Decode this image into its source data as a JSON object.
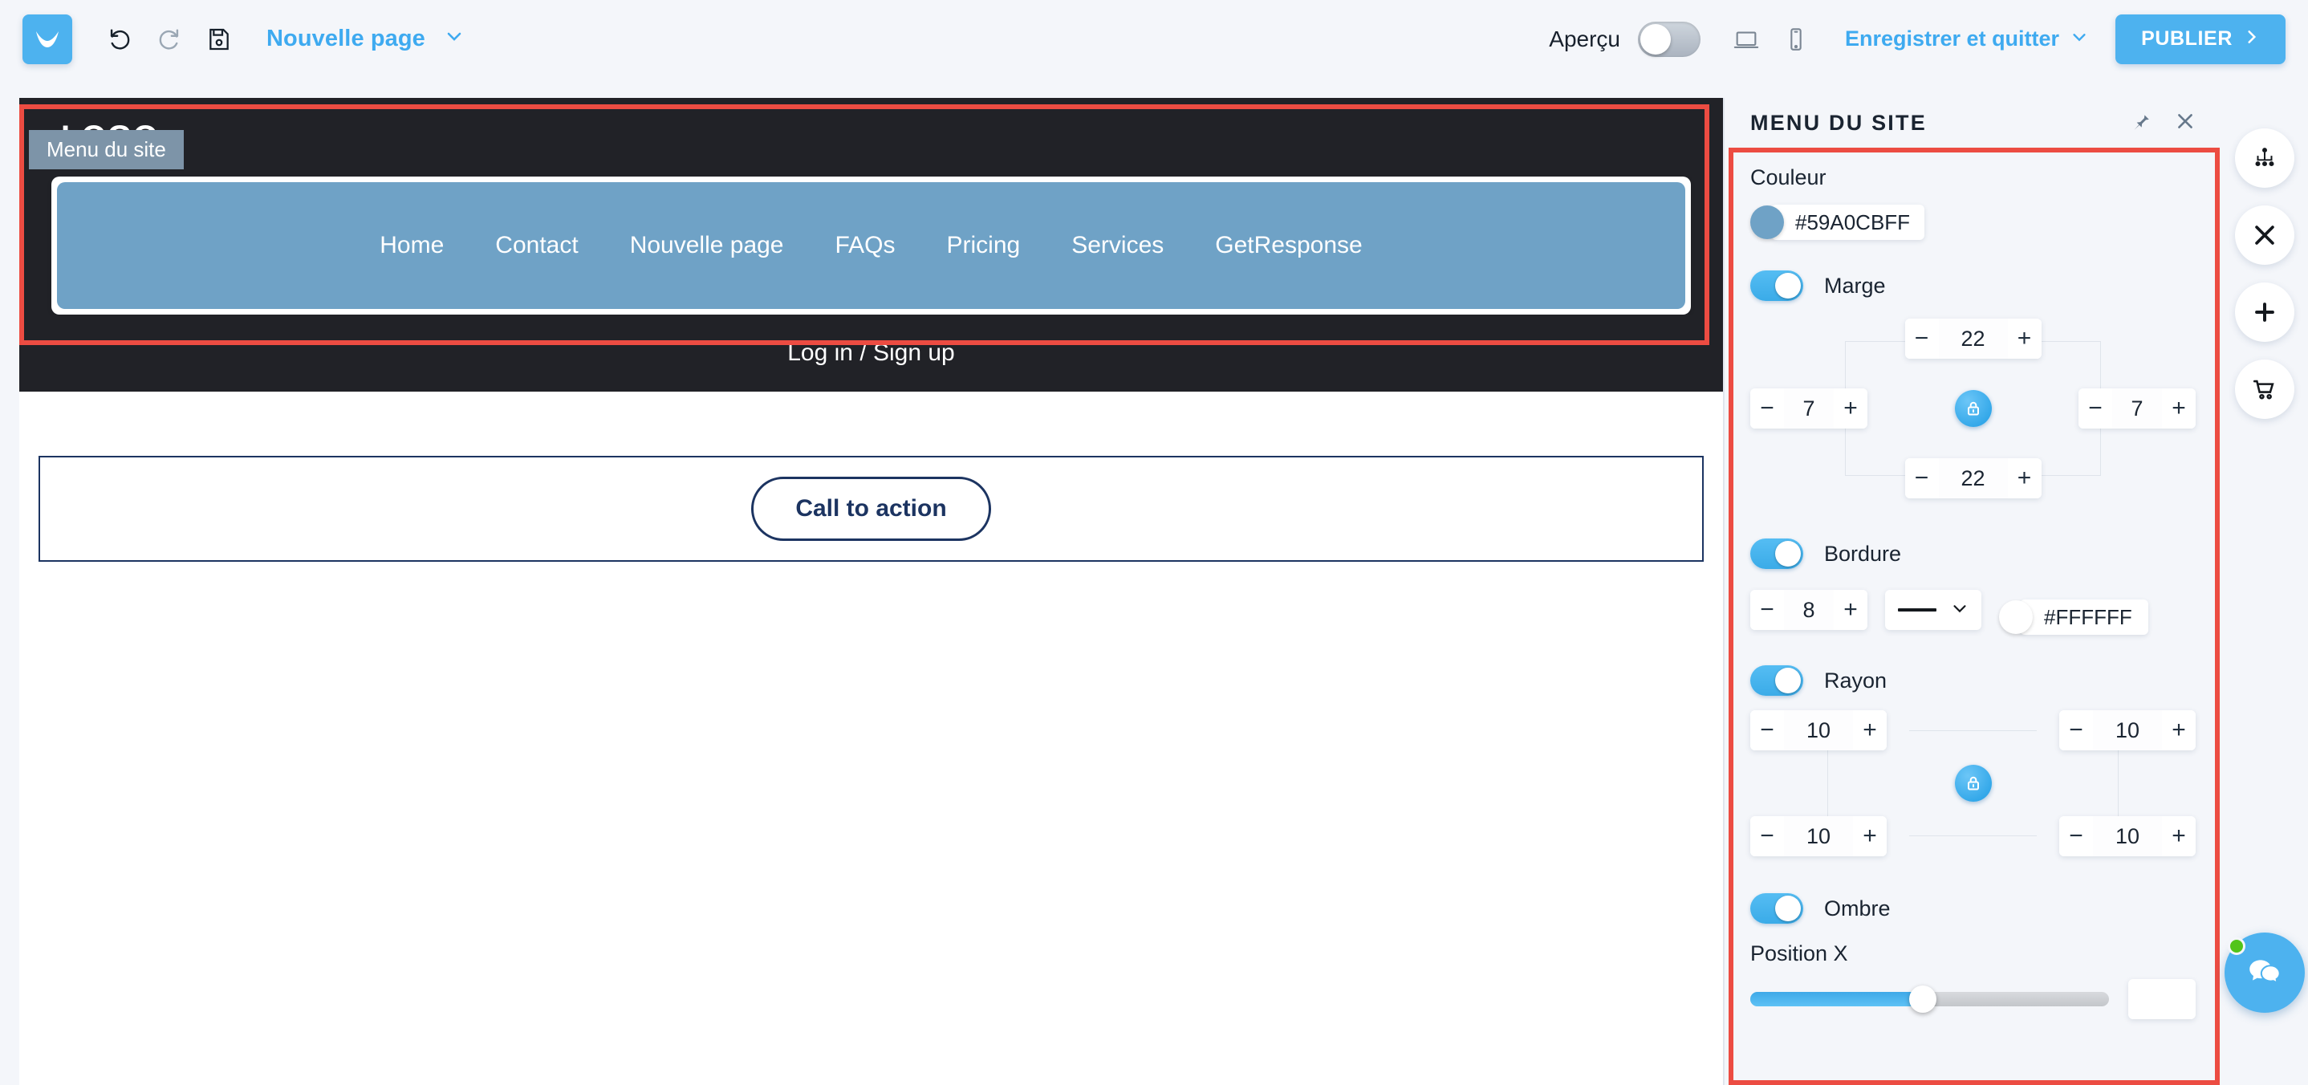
{
  "topbar": {
    "brand_icon": "getresponse-logo-icon",
    "undo_icon": "undo-icon",
    "redo_icon": "redo-icon",
    "save_icon": "save-disk-icon",
    "page_name": "Nouvelle page",
    "page_chevron_icon": "chevron-down-icon",
    "preview_label": "Aperçu",
    "preview_toggle_state": "off",
    "desktop_icon": "desktop-icon",
    "mobile_icon": "mobile-icon",
    "save_and_quit_label": "Enregistrer et quitter",
    "save_and_quit_chevron": "chevron-down-icon",
    "publish_label": "PUBLIER",
    "publish_arrow_icon": "chevron-right-icon",
    "accent_color": "#4db2ef"
  },
  "canvas": {
    "selection_badge": "Menu du site",
    "selection_color": "#ec4c42",
    "site_logo": "LOGO",
    "header_bg": "#212227",
    "nav_bg": "#6fa2c6",
    "nav_items": [
      {
        "label": "Home"
      },
      {
        "label": "Contact"
      },
      {
        "label": "Nouvelle page"
      },
      {
        "label": "FAQs"
      },
      {
        "label": "Pricing"
      },
      {
        "label": "Services"
      },
      {
        "label": "GetResponse"
      }
    ],
    "login_text": "Log in / Sign up",
    "cta_label": "Call to action",
    "cta_color": "#1c3461"
  },
  "panel": {
    "title": "MENU DU SITE",
    "pin_icon": "pin-icon",
    "close_icon": "close-icon",
    "color": {
      "label": "Couleur",
      "value": "#59A0CBFF",
      "swatch": "#6fa2c6"
    },
    "margin": {
      "label": "Marge",
      "toggle_state": "on",
      "top": "22",
      "right": "7",
      "bottom": "22",
      "left": "7",
      "lock_icon": "lock-icon",
      "minus": "−",
      "plus": "+"
    },
    "border": {
      "label": "Bordure",
      "toggle_state": "on",
      "width": "8",
      "style_icon": "solid-line-icon",
      "style_chevron": "chevron-down-icon",
      "color_value": "#FFFFFF",
      "color_swatch": "#ffffff"
    },
    "radius": {
      "label": "Rayon",
      "toggle_state": "on",
      "top_left": "10",
      "top_right": "10",
      "bottom_left": "10",
      "bottom_right": "10",
      "lock_icon": "lock-icon"
    },
    "shadow": {
      "label": "Ombre",
      "toggle_state": "on",
      "position_x_label": "Position X",
      "position_x_value": ""
    }
  },
  "rail": {
    "sitemap_icon": "sitemap-icon",
    "close_icon": "close-x-icon",
    "add_icon": "plus-icon",
    "cart_icon": "shopping-cart-icon",
    "chat_icon": "chat-bubbles-icon",
    "chat_status": "online"
  }
}
